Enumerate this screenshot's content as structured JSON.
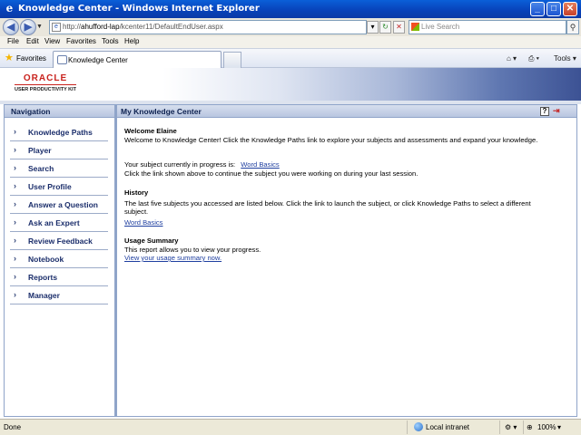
{
  "window": {
    "title": "Knowledge Center - Windows Internet Explorer",
    "controls": [
      "_",
      "□",
      "✕"
    ]
  },
  "address": {
    "url_prefix": "http://",
    "url_host": "ahufford-lap",
    "url_path": "/kcenter11/DefaultEndUser.aspx",
    "search_placeholder": "Live Search"
  },
  "menu": [
    "File",
    "Edit",
    "View",
    "Favorites",
    "Tools",
    "Help"
  ],
  "favorites_bar": {
    "favorites_label": "Favorites",
    "tab_title": "Knowledge Center",
    "tools_label": "Tools"
  },
  "header": {
    "logo_brand": "ORACLE",
    "logo_product": "USER PRODUCTIVITY KIT"
  },
  "nav": {
    "title": "Navigation",
    "items": [
      {
        "label": "Knowledge Paths"
      },
      {
        "label": "Player"
      },
      {
        "label": "Search"
      },
      {
        "label": "User Profile"
      },
      {
        "label": "Answer a Question"
      },
      {
        "label": "Ask an Expert"
      },
      {
        "label": "Review Feedback"
      },
      {
        "label": "Notebook"
      },
      {
        "label": "Reports"
      },
      {
        "label": "Manager"
      }
    ]
  },
  "main": {
    "title": "My Knowledge Center",
    "welcome_heading": "Welcome Elaine",
    "welcome_text": "Welcome to Knowledge Center! Click the Knowledge Paths link to explore your subjects and assessments and expand your knowledge.",
    "progress_label": "Your subject currently in progress is:",
    "progress_link": "Word Basics",
    "progress_text": "Click the link shown above to continue the subject you were working on during your last session.",
    "history_heading": "History",
    "history_text_1": "The last five subjects you accessed are listed below. Click the link to launch the subject, or click Knowledge Paths to select a different",
    "history_text_2": "subject.",
    "history_link": "Word Basics",
    "usage_heading": "Usage Summary",
    "usage_text": "This report allows you to view your progress.",
    "usage_link": "View your usage summary now."
  },
  "status": {
    "left": "Done",
    "zone": "Local intranet",
    "zoom": "100%"
  }
}
